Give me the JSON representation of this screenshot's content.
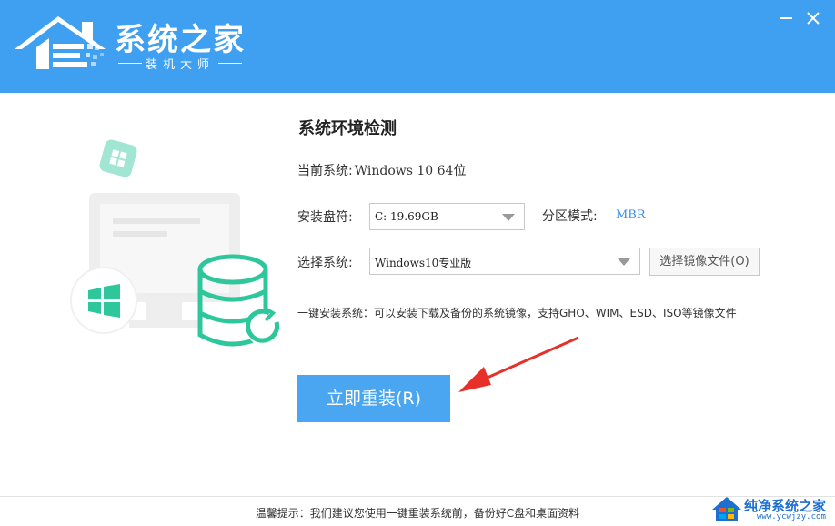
{
  "brand": {
    "title": "系统之家",
    "subtitle": "装机大师"
  },
  "main": {
    "section_title": "系统环境检测",
    "current_system_label": "当前系统:",
    "current_system_value": "Windows 10 64位",
    "drive_label": "安装盘符:",
    "drive_value": "C: 19.69GB",
    "partition_label": "分区模式:",
    "partition_value": "MBR",
    "system_label": "选择系统:",
    "system_value": "Windows10专业版",
    "browse_label": "选择镜像文件(O)",
    "note": "一键安装系统：可以安装下载及备份的系统镜像，支持GHO、WIM、ESD、ISO等镜像文件",
    "reinstall_label": "立即重装(R)"
  },
  "footer": {
    "tip": "温馨提示：我们建议您使用一键重装系统前，备份好C盘和桌面资料"
  },
  "watermark": {
    "title": "纯净系统之家",
    "url": "www.ycwjzy.com"
  },
  "colors": {
    "header_bg": "#3fa0f2",
    "primary_button": "#4aa6f0",
    "illustration_green": "#2ec79b",
    "annotation_arrow": "#e8302a"
  },
  "icons": {
    "logo": "house-logo-icon",
    "minimize": "minimize-icon",
    "close": "close-icon",
    "windows": "windows-logo-icon",
    "database": "database-refresh-icon"
  }
}
